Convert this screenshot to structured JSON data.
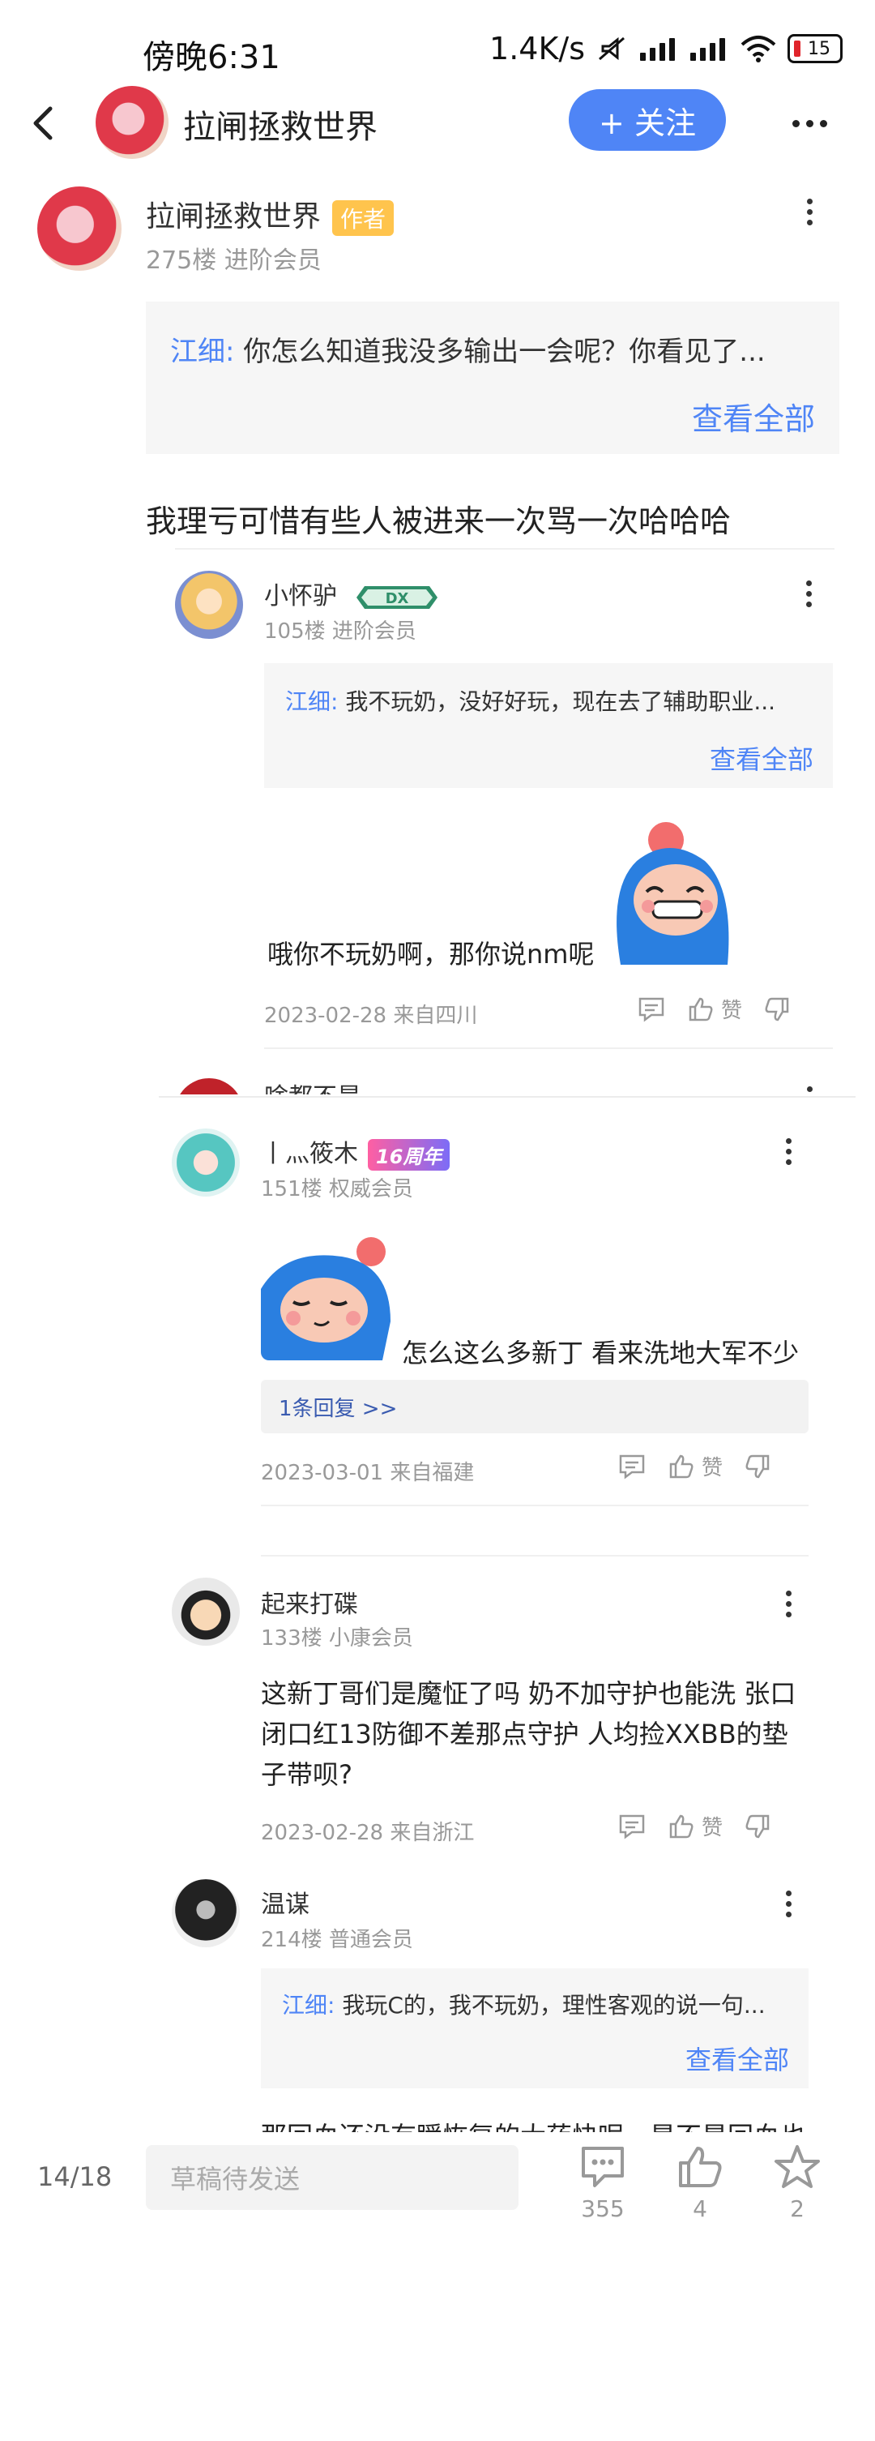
{
  "status": {
    "time": "傍晚6:31",
    "net_speed": "1.4K/s",
    "battery": "15"
  },
  "header": {
    "title": "拉闸拯救世界",
    "follow_label": "+ 关注"
  },
  "op": {
    "name": "拉闸拯救世界",
    "tag": "作者",
    "meta": "275楼  进阶会员",
    "quote_name": "江细:",
    "quote_text": " 你怎么知道我没多输出一会呢？你看见了...",
    "see_all": "查看全部",
    "content": "我理亏可惜有些人被进来一次骂一次哈哈哈"
  },
  "replies": [
    {
      "name": "小怀驴",
      "badge": "DX",
      "meta": "105楼  进阶会员",
      "quote_name": "江细:",
      "quote_text": " 我不玩奶，没好好玩，现在去了辅助职业...",
      "see_all": "查看全部",
      "content": "哦你不玩奶啊，那你说nm呢",
      "date": "2023-02-28  来自四川",
      "like": "赞"
    },
    {
      "name": "啥都不是",
      "meta": ""
    },
    {
      "name": "丨灬筱木",
      "badge": "16周年",
      "meta": "151楼  权威会员",
      "content": "怎么这么多新丁  看来洗地大军不少",
      "reply_count": "1条回复 >>",
      "date": "2023-03-01  来自福建",
      "like": "赞"
    },
    {
      "name": "起来打碟",
      "meta": "133楼  小康会员",
      "content": "这新丁哥们是魔怔了吗  奶不加守护也能洗  张口闭口红13防御不差那点守护  人均捡XXBB的垫子带呗?",
      "date": "2023-02-28  来自浙江",
      "like": "赞"
    },
    {
      "name": "温谋",
      "meta": "214楼  普通会员",
      "quote_name": "江细:",
      "quote_text": " 我玩C的，我不玩奶，理性客观的说一句...",
      "see_all": "查看全部",
      "content": "那回血还没有瞬恢复的大药快呢，是不是回血也不用给了，不给说奶不会玩，给了又嫌弃低，真"
    }
  ],
  "bottom": {
    "page": "14/18",
    "placeholder": "草稿待发送",
    "comments": "355",
    "likes": "4",
    "stars": "2"
  }
}
